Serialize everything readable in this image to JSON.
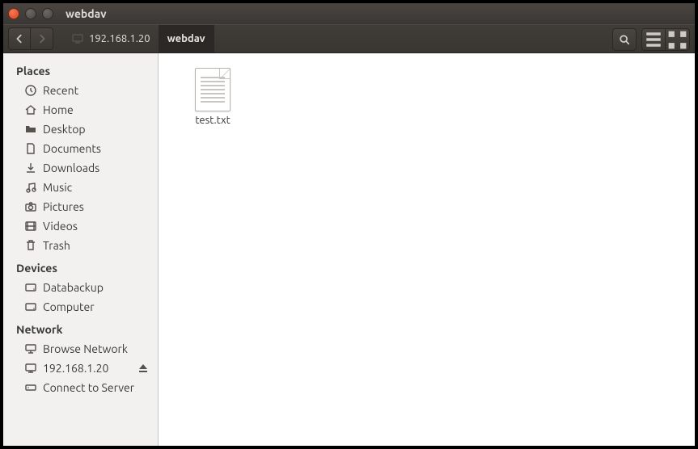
{
  "window": {
    "title": "webdav"
  },
  "path": {
    "host_label": "192.168.1.20",
    "current": "webdav"
  },
  "sidebar": {
    "places_header": "Places",
    "devices_header": "Devices",
    "network_header": "Network",
    "places": [
      {
        "label": "Recent"
      },
      {
        "label": "Home"
      },
      {
        "label": "Desktop"
      },
      {
        "label": "Documents"
      },
      {
        "label": "Downloads"
      },
      {
        "label": "Music"
      },
      {
        "label": "Pictures"
      },
      {
        "label": "Videos"
      },
      {
        "label": "Trash"
      }
    ],
    "devices": [
      {
        "label": "Databackup"
      },
      {
        "label": "Computer"
      }
    ],
    "network": [
      {
        "label": "Browse Network"
      },
      {
        "label": "192.168.1.20",
        "ejectable": true
      },
      {
        "label": "Connect to Server"
      }
    ]
  },
  "files": [
    {
      "name": "test.txt"
    }
  ]
}
